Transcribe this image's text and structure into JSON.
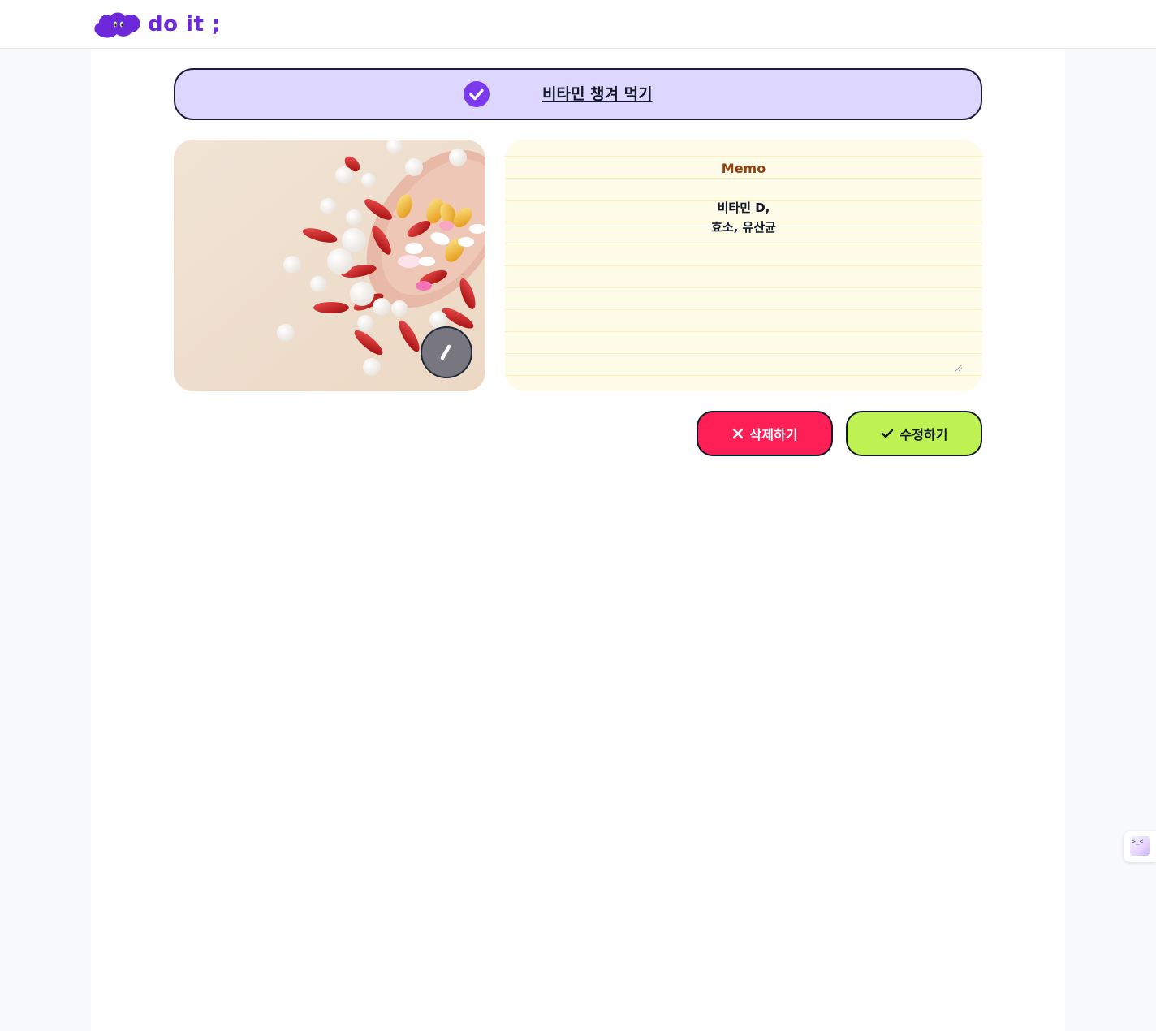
{
  "header": {
    "logo_text": "do it ;",
    "brand_color": "#6d28d9"
  },
  "todo": {
    "title": "비타민 챙겨 먹기",
    "completed": true,
    "check_color": "#7c3aed"
  },
  "memo": {
    "heading": "Memo",
    "content": "비타민 D,\n효소, 유산균"
  },
  "actions": {
    "delete_label": "삭제하기",
    "edit_label": "수정하기",
    "delete_color": "#ff1f57",
    "edit_color": "#bef252"
  },
  "widget": {
    "face_text": ">_<"
  },
  "icons": {
    "check": "check-icon",
    "edit_image": "pencil-icon",
    "delete": "close-icon",
    "edit": "checkmark-icon"
  }
}
